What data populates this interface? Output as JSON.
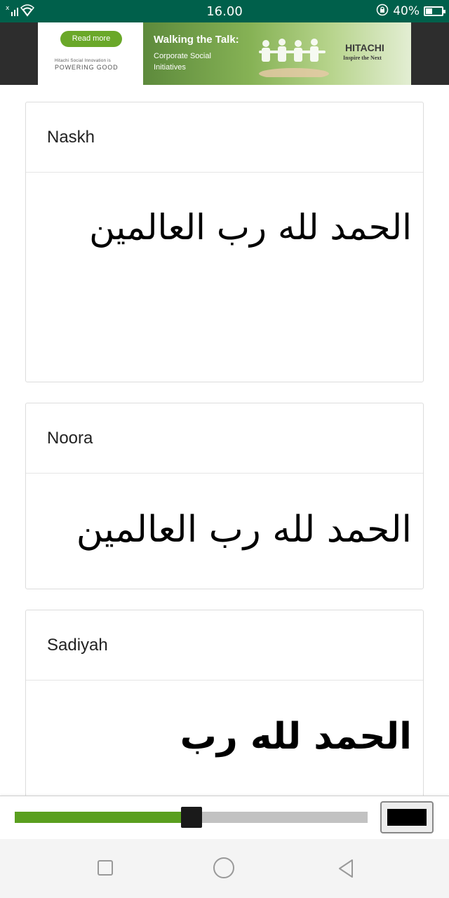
{
  "status_bar": {
    "time": "16.00",
    "battery_text": "40%",
    "battery_level": 0.4,
    "icons": [
      "signal-icon",
      "wifi-icon",
      "rotation-lock-icon",
      "battery-icon"
    ]
  },
  "ad": {
    "read_more": "Read more",
    "brand_line_1": "Hitachi Social Innovation is",
    "brand_line_2": "POWERING GOOD",
    "headline": "Walking the Talk:",
    "subline": "Corporate Social Initiatives",
    "logo": "HITACHI",
    "tagline": "Inspire the Next"
  },
  "cards": [
    {
      "title": "Naskh",
      "sample": "الحمد لله رب العالمين"
    },
    {
      "title": "Noora",
      "sample": "الحمد لله رب العالمين"
    },
    {
      "title": "Sadiyah",
      "sample": "الحمد لله رب"
    }
  ],
  "slider": {
    "value": 0.5
  },
  "color_button": {
    "color": "#000000"
  },
  "colors": {
    "status_bar": "#00604b",
    "accent": "#5a9f1f"
  },
  "nav": {
    "icons": [
      "recent-apps-icon",
      "home-icon",
      "back-icon"
    ]
  }
}
